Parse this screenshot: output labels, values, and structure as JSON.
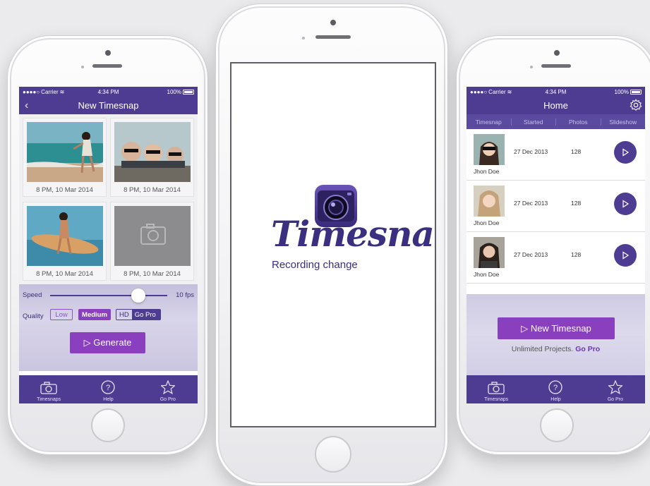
{
  "left_phone": {
    "status": {
      "carrier": "Carrier",
      "time": "4:34 PM",
      "battery": "100%"
    },
    "title": "New Timesnap",
    "photos": [
      {
        "caption": "8 PM, 10 Mar 2014",
        "icon": "photo-beach"
      },
      {
        "caption": "8 PM, 10 Mar 2014",
        "icon": "photo-friends"
      },
      {
        "caption": "8 PM, 10 Mar 2014",
        "icon": "photo-surfer"
      },
      {
        "caption": "8 PM, 10 Mar 2014",
        "icon": "camera-placeholder-icon"
      }
    ],
    "speed_label": "Speed",
    "speed_value": "10 fps",
    "speed_level": 0.75,
    "quality_label": "Quality",
    "quality_low": "Low",
    "quality_medium": "Medium",
    "quality_hd": "HD",
    "quality_gopro": "Go Pro",
    "generate": "▷ Generate",
    "tabs": [
      {
        "label": "Timesnaps",
        "icon": "camera-icon"
      },
      {
        "label": "Help",
        "icon": "help-icon"
      },
      {
        "label": "Go Pro",
        "icon": "star-icon"
      }
    ]
  },
  "center_phone": {
    "brand": "Timesnaps",
    "tagline": "Recording change"
  },
  "right_phone": {
    "status": {
      "carrier": "Carrier",
      "time": "4:34 PM",
      "battery": "100%"
    },
    "title": "Home",
    "subtabs": [
      "Timesnap",
      "Started",
      "Photos",
      "Slideshow"
    ],
    "rows": [
      {
        "name": "Jhon Doe",
        "date": "27 Dec 2013",
        "count": "128"
      },
      {
        "name": "Jhon Doe",
        "date": "27 Dec 2013",
        "count": "128"
      },
      {
        "name": "Jhon Doe",
        "date": "27 Dec 2013",
        "count": "128"
      }
    ],
    "new_button": "▷ New Timesnap",
    "unlimited_text": "Unlimited Projects.",
    "unlimited_link": "Go Pro",
    "tabs": [
      {
        "label": "Timesnaps",
        "icon": "camera-icon"
      },
      {
        "label": "Help",
        "icon": "help-icon"
      },
      {
        "label": "Go Pro",
        "icon": "star-icon"
      }
    ]
  },
  "colors": {
    "primary": "#4e3c92",
    "accent": "#8a3fbf",
    "background": "#ebebed"
  }
}
